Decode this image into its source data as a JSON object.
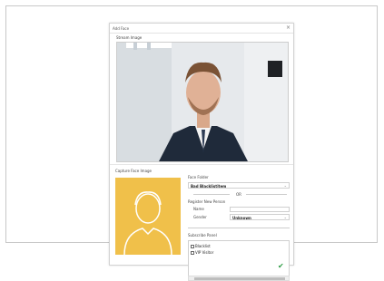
{
  "dialog": {
    "title": "Add Face",
    "close_icon": "close-icon"
  },
  "stream": {
    "label": "Stream Image"
  },
  "capture": {
    "label": "Capture Face Image"
  },
  "form": {
    "face_folder_label": "Face Folder",
    "face_folder_value": "Bad Blacklistitem",
    "or_label": "OR",
    "register_label": "Register New Person",
    "name_label": "Name",
    "gender_label": "Gender",
    "gender_value": "Unknown"
  },
  "subscribe": {
    "label": "Subscribe Panel",
    "items": [
      {
        "label": "Blacklist"
      },
      {
        "label": "VIP Visitor"
      }
    ]
  },
  "colors": {
    "crop_bg": "#f0c04a",
    "confirm": "#2e9b45"
  }
}
